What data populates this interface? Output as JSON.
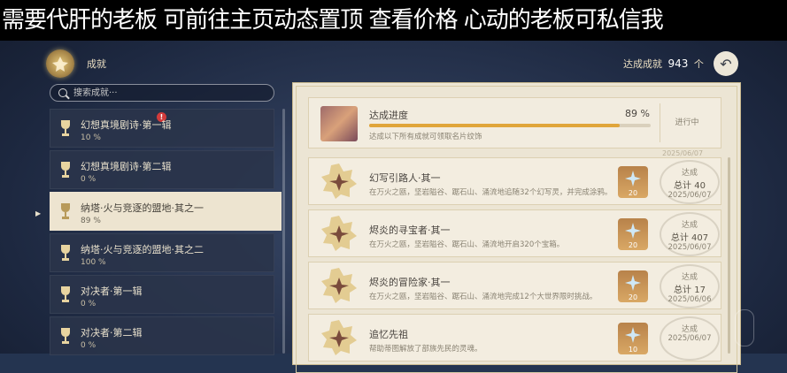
{
  "banner": {
    "text": "需要代肝的老板 可前往主页动态置顶 查看价格 心动的老板可私信我"
  },
  "header": {
    "category_title": "成就",
    "total_label": "达成成就",
    "total_count": "943",
    "total_unit": "个"
  },
  "search": {
    "placeholder": "搜索成就···"
  },
  "categories": [
    {
      "name": "幻想真境剧诗·第一辑",
      "percent": "10 %",
      "badge": "!"
    },
    {
      "name": "幻想真境剧诗·第二辑",
      "percent": "0 %"
    },
    {
      "name": "纳塔·火与竞逐的盟地·其之一",
      "percent": "89 %"
    },
    {
      "name": "纳塔·火与竞逐的盟地·其之二",
      "percent": "100 %"
    },
    {
      "name": "对决者·第一辑",
      "percent": "0 %"
    },
    {
      "name": "对决者·第二辑",
      "percent": "0 %"
    }
  ],
  "progress": {
    "title": "达成进度",
    "percent_label": "89 %",
    "fraction": 0.89,
    "desc": "达成以下所有成就可领取名片纹饰",
    "status": "进行中"
  },
  "stub_date": "2025/06/07",
  "achievements": [
    {
      "name": "幻写引路人·其一",
      "desc": "在万火之瓯，坚岩隘谷、踞石山、涌流地追随32个幻写灵，并完成涂鸦。",
      "reward": "20",
      "status": "达成",
      "total": "总计 40",
      "date": "2025/06/07"
    },
    {
      "name": "烬炎的寻宝者·其一",
      "desc": "在万火之瓯，坚岩隘谷、踞石山、涌流地开启320个宝箱。",
      "reward": "20",
      "status": "达成",
      "total": "总计 407",
      "date": "2025/06/07"
    },
    {
      "name": "烬炎的冒险家·其一",
      "desc": "在万火之瓯，坚岩隘谷、踞石山、涌流地完成12个大世界限时挑战。",
      "reward": "20",
      "status": "达成",
      "total": "总计 17",
      "date": "2025/06/06"
    },
    {
      "name": "追忆先祖",
      "desc": "帮助蒂图解放了部族先民的灵魂。",
      "reward": "10",
      "status": "达成",
      "total": "",
      "date": "2025/06/07"
    }
  ],
  "icons": {
    "crest": "achievement-crest-icon",
    "back": "back-arrow-icon",
    "search": "search-icon",
    "trophy": "trophy-icon",
    "medal": "medal-icon",
    "primogem": "primogem-icon"
  },
  "colors": {
    "accent": "#e0a53a",
    "panel": "#ece5d4",
    "badge": "#d23b3b"
  }
}
